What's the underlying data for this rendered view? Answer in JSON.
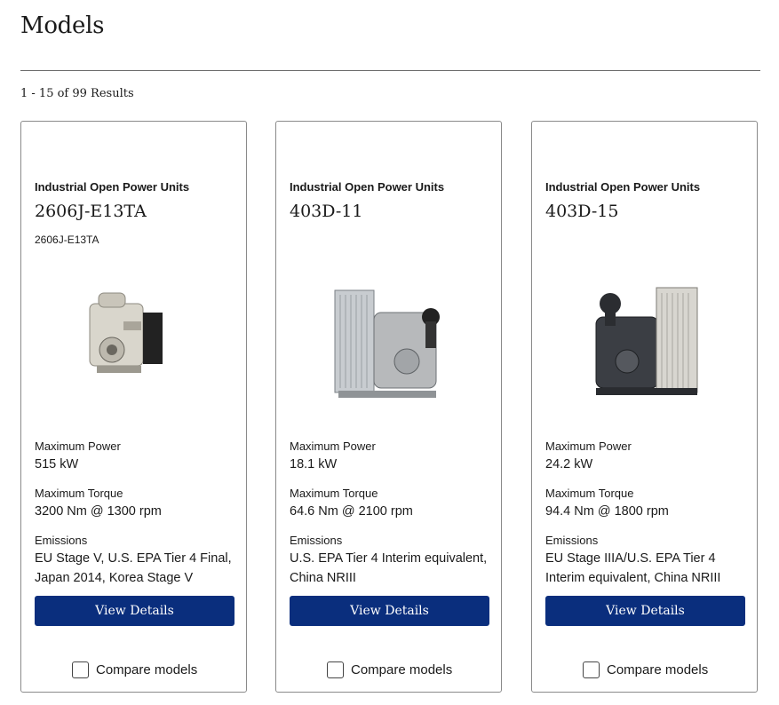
{
  "page": {
    "title": "Models",
    "results": "1 - 15 of 99 Results"
  },
  "cards": [
    {
      "category": "Industrial Open Power Units",
      "name": "2606J-E13TA",
      "subtitle": "2606J-E13TA",
      "image_icon": "engine-image",
      "power_label": "Maximum Power",
      "power": "515 kW",
      "torque_label": "Maximum Torque",
      "torque": "3200 Nm @ 1300 rpm",
      "emissions_label": "Emissions",
      "emissions": "EU Stage V, U.S. EPA Tier 4 Final, Japan 2014, Korea Stage V",
      "button": "View Details",
      "compare": "Compare models"
    },
    {
      "category": "Industrial Open Power Units",
      "name": "403D-11",
      "subtitle": "",
      "image_icon": "engine-image",
      "power_label": "Maximum Power",
      "power": "18.1 kW",
      "torque_label": "Maximum Torque",
      "torque": "64.6 Nm @ 2100 rpm",
      "emissions_label": "Emissions",
      "emissions": "U.S. EPA Tier 4 Interim equivalent, China NRIII",
      "button": "View Details",
      "compare": "Compare models"
    },
    {
      "category": "Industrial Open Power Units",
      "name": "403D-15",
      "subtitle": "",
      "image_icon": "engine-image",
      "power_label": "Maximum Power",
      "power": "24.2 kW",
      "torque_label": "Maximum Torque",
      "torque": "94.4 Nm @ 1800 rpm",
      "emissions_label": "Emissions",
      "emissions": "EU Stage IIIA/U.S. EPA Tier 4 Interim equivalent, China NRIII",
      "button": "View Details",
      "compare": "Compare models"
    }
  ],
  "colors": {
    "button": "#0a2e7d",
    "border": "#8a8a8a"
  }
}
